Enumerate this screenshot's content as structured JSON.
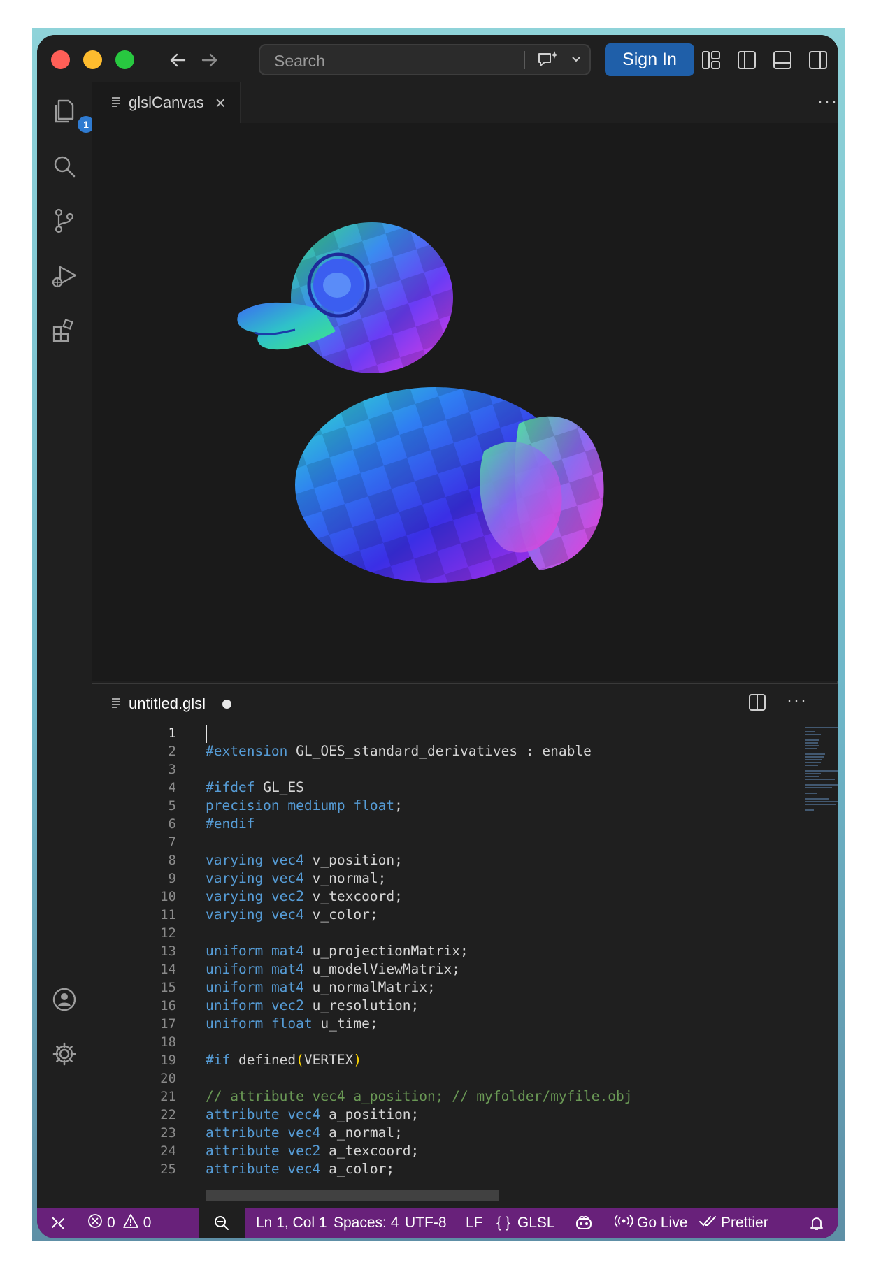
{
  "titlebar": {
    "search_placeholder": "Search",
    "sign_in_label": "Sign In"
  },
  "activity_bar": {
    "explorer_badge": "1"
  },
  "top_group": {
    "tab_label": "glslCanvas",
    "more_label": "···"
  },
  "bottom_group": {
    "tab_label": "untitled.glsl",
    "more_label": "···"
  },
  "editor": {
    "lines": [
      {
        "n": "1",
        "text": ""
      },
      {
        "n": "2",
        "text": "#extension GL_OES_standard_derivatives : enable"
      },
      {
        "n": "3",
        "text": ""
      },
      {
        "n": "4",
        "text": "#ifdef GL_ES"
      },
      {
        "n": "5",
        "text": "precision mediump float;"
      },
      {
        "n": "6",
        "text": "#endif"
      },
      {
        "n": "7",
        "text": ""
      },
      {
        "n": "8",
        "text": "varying vec4 v_position;"
      },
      {
        "n": "9",
        "text": "varying vec4 v_normal;"
      },
      {
        "n": "10",
        "text": "varying vec2 v_texcoord;"
      },
      {
        "n": "11",
        "text": "varying vec4 v_color;"
      },
      {
        "n": "12",
        "text": ""
      },
      {
        "n": "13",
        "text": "uniform mat4 u_projectionMatrix;"
      },
      {
        "n": "14",
        "text": "uniform mat4 u_modelViewMatrix;"
      },
      {
        "n": "15",
        "text": "uniform mat4 u_normalMatrix;"
      },
      {
        "n": "16",
        "text": "uniform vec2 u_resolution;"
      },
      {
        "n": "17",
        "text": "uniform float u_time;"
      },
      {
        "n": "18",
        "text": ""
      },
      {
        "n": "19",
        "text": "#if defined(VERTEX)"
      },
      {
        "n": "20",
        "text": ""
      },
      {
        "n": "21",
        "text": "// attribute vec4 a_position; // myfolder/myfile.obj"
      },
      {
        "n": "22",
        "text": "attribute vec4 a_position;"
      },
      {
        "n": "23",
        "text": "attribute vec4 a_normal;"
      },
      {
        "n": "24",
        "text": "attribute vec2 a_texcoord;"
      },
      {
        "n": "25",
        "text": "attribute vec4 a_color;"
      }
    ],
    "keyword_color": "#569cd6",
    "comment_color": "#6a9955"
  },
  "status_bar": {
    "errors": "0",
    "warnings": "0",
    "cursor": "Ln 1, Col 1",
    "spaces": "Spaces: 4",
    "encoding": "UTF-8",
    "eol": "LF",
    "language": "GLSL",
    "go_live": "Go Live",
    "prettier": "Prettier",
    "background_color": "#68217a"
  }
}
